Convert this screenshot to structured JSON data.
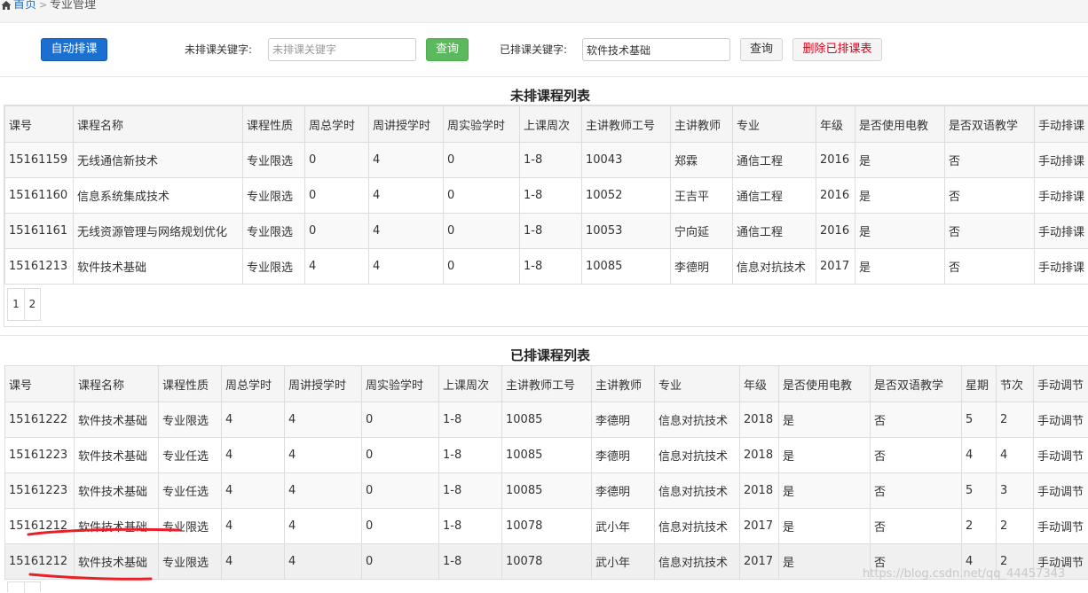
{
  "breadcrumb": {
    "home": "首页",
    "separator": ">",
    "current": "专业管理"
  },
  "toolbar": {
    "auto_schedule_label": "自动排课",
    "unscheduled_keyword_label": "未排课关键字:",
    "unscheduled_keyword_placeholder": "未排课关键字",
    "unscheduled_query_label": "查询",
    "scheduled_keyword_label": "已排课关键字:",
    "scheduled_keyword_value": "软件技术基础",
    "scheduled_query_label": "查询",
    "delete_scheduled_label": "删除已排课表",
    "colors": {
      "primary": "#1a6fd0",
      "success": "#5cb85c",
      "danger_text": "#d9001b"
    }
  },
  "unscheduled": {
    "title": "未排课程列表",
    "headers": [
      "课号",
      "课程名称",
      "课程性质",
      "周总学时",
      "周讲授学时",
      "周实验学时",
      "上课周次",
      "主讲教师工号",
      "主讲教师",
      "专业",
      "年级",
      "是否使用电教",
      "是否双语教学",
      "手动排课"
    ],
    "rows": [
      [
        "15161159",
        "无线通信新技术",
        "专业限选",
        "0",
        "4",
        "0",
        "1-8",
        "10043",
        "郑霖",
        "通信工程",
        "2016",
        "是",
        "否",
        "手动排课"
      ],
      [
        "15161160",
        "信息系统集成技术",
        "专业限选",
        "0",
        "4",
        "0",
        "1-8",
        "10052",
        "王吉平",
        "通信工程",
        "2016",
        "是",
        "否",
        "手动排课"
      ],
      [
        "15161161",
        "无线资源管理与网络规划优化",
        "专业限选",
        "0",
        "4",
        "0",
        "1-8",
        "10053",
        "宁向延",
        "通信工程",
        "2016",
        "是",
        "否",
        "手动排课"
      ],
      [
        "15161213",
        "软件技术基础",
        "专业限选",
        "4",
        "4",
        "0",
        "1-8",
        "10085",
        "李德明",
        "信息对抗技术",
        "2017",
        "是",
        "否",
        "手动排课"
      ]
    ],
    "pages": [
      "1",
      "2"
    ]
  },
  "scheduled": {
    "title": "已排课程列表",
    "headers": [
      "课号",
      "课程名称",
      "课程性质",
      "周总学时",
      "周讲授学时",
      "周实验学时",
      "上课周次",
      "主讲教师工号",
      "主讲教师",
      "专业",
      "年级",
      "是否使用电教",
      "是否双语教学",
      "星期",
      "节次",
      "手动调节"
    ],
    "rows": [
      [
        "15161222",
        "软件技术基础",
        "专业限选",
        "4",
        "4",
        "0",
        "1-8",
        "10085",
        "李德明",
        "信息对抗技术",
        "2018",
        "是",
        "否",
        "5",
        "2",
        "手动调节"
      ],
      [
        "15161223",
        "软件技术基础",
        "专业任选",
        "4",
        "4",
        "0",
        "1-8",
        "10085",
        "李德明",
        "信息对抗技术",
        "2018",
        "是",
        "否",
        "4",
        "4",
        "手动调节"
      ],
      [
        "15161223",
        "软件技术基础",
        "专业任选",
        "4",
        "4",
        "0",
        "1-8",
        "10085",
        "李德明",
        "信息对抗技术",
        "2018",
        "是",
        "否",
        "5",
        "3",
        "手动调节"
      ],
      [
        "15161212",
        "软件技术基础",
        "专业限选",
        "4",
        "4",
        "0",
        "1-8",
        "10078",
        "武小年",
        "信息对抗技术",
        "2017",
        "是",
        "否",
        "2",
        "2",
        "手动调节"
      ],
      [
        "15161212",
        "软件技术基础",
        "专业限选",
        "4",
        "4",
        "0",
        "1-8",
        "10078",
        "武小年",
        "信息对抗技术",
        "2017",
        "是",
        "否",
        "4",
        "2",
        "手动调节"
      ]
    ]
  },
  "watermark": "https://blog.csdn.net/qq_44457343"
}
